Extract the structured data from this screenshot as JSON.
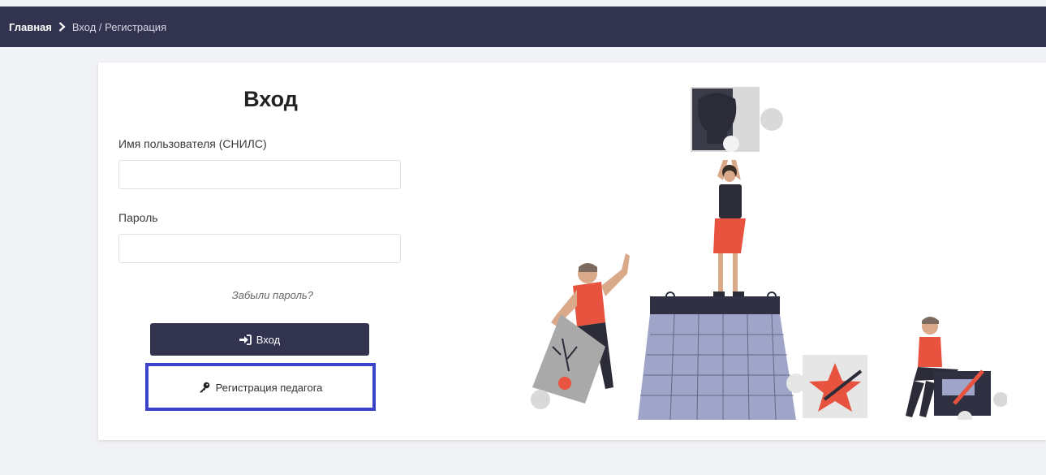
{
  "breadcrumb": {
    "home": "Главная",
    "current": "Вход / Регистрация"
  },
  "login": {
    "title": "Вход",
    "username_label": "Имя пользователя (СНИЛС)",
    "username_value": "",
    "password_label": "Пароль",
    "password_value": "",
    "forgot_link": "Забыли пароль?",
    "login_button": "Вход",
    "register_button": "Регистрация педагога"
  },
  "colors": {
    "header_bg": "#31334f",
    "primary_button": "#31334f",
    "highlight_border": "#3a43c9",
    "accent_red": "#e8533f"
  },
  "icons": {
    "breadcrumb_separator": "chevron-right-icon",
    "login_button_icon": "sign-in-icon",
    "register_button_icon": "key-icon"
  }
}
